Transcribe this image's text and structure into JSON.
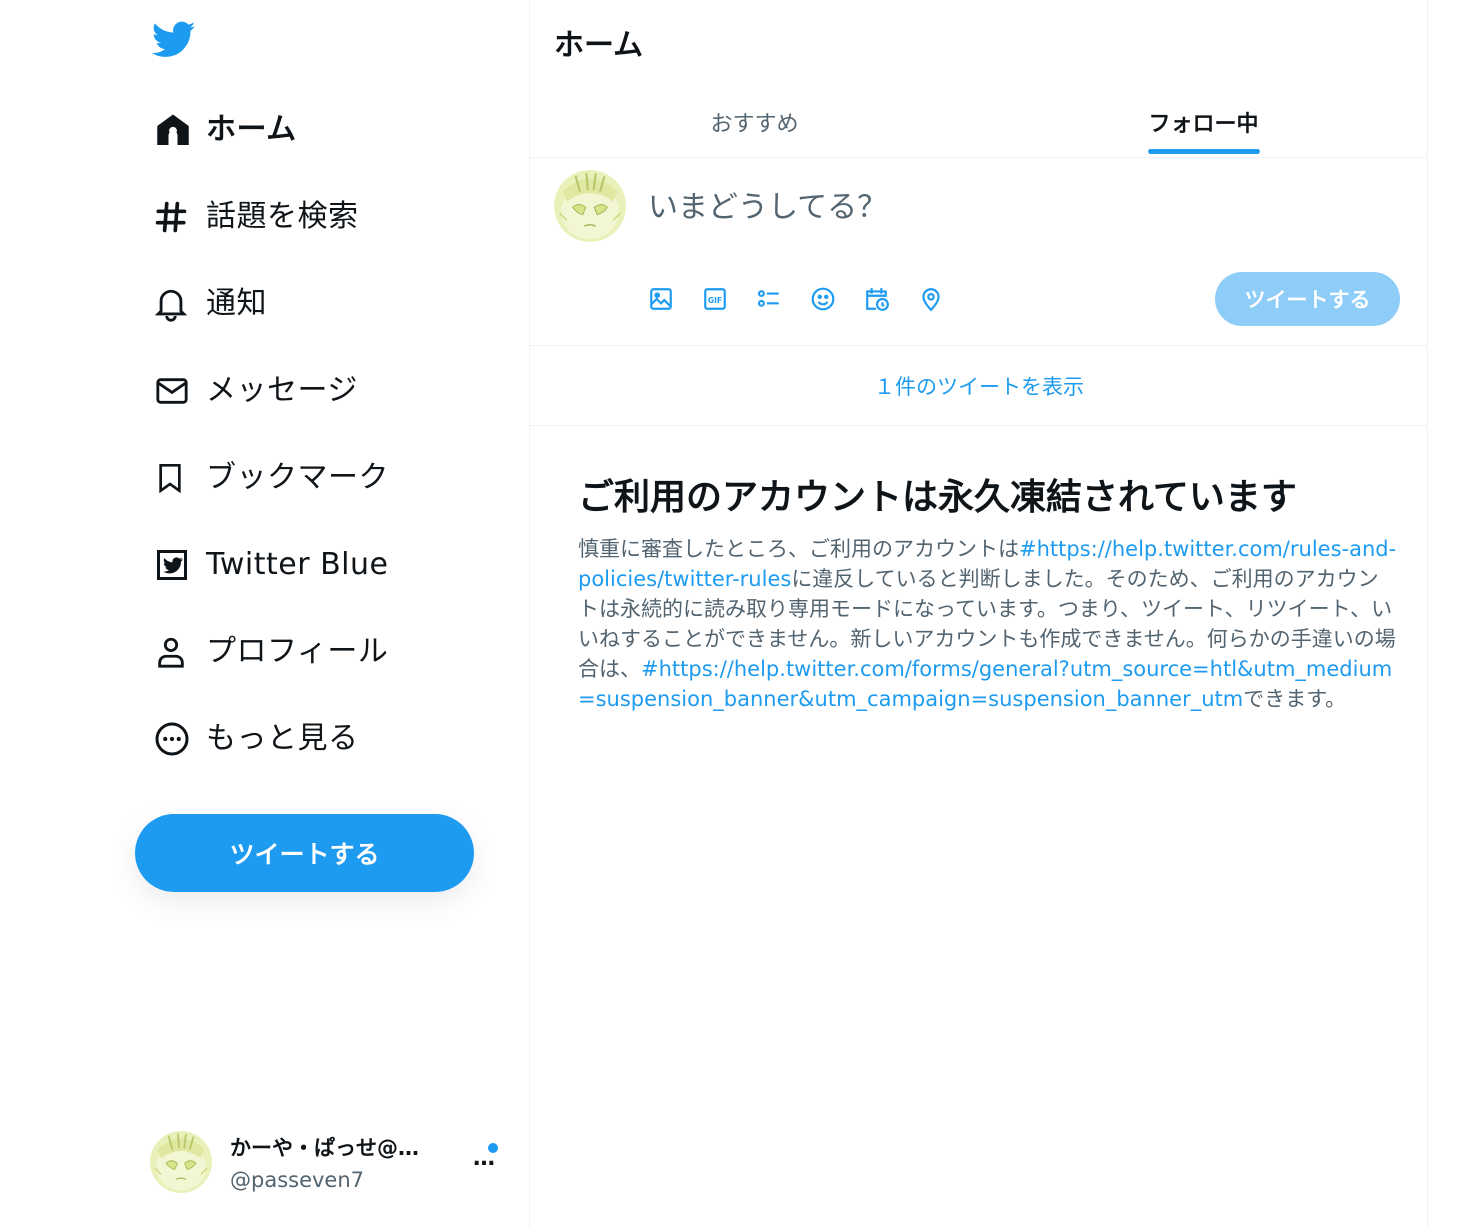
{
  "colors": {
    "accent": "#1d9bf0",
    "accent_disabled": "#8ecdf8",
    "text_primary": "#0f1419",
    "text_secondary": "#536471",
    "border": "#eff3f4"
  },
  "sidebar": {
    "logo_icon": "twitter-bird-icon",
    "nav": [
      {
        "label": "ホーム",
        "icon": "home-icon",
        "active": true
      },
      {
        "label": "話題を検索",
        "icon": "hashtag-icon"
      },
      {
        "label": "通知",
        "icon": "bell-icon"
      },
      {
        "label": "メッセージ",
        "icon": "envelope-icon"
      },
      {
        "label": "ブックマーク",
        "icon": "bookmark-icon"
      },
      {
        "label": "Twitter Blue",
        "icon": "twitter-blue-icon"
      },
      {
        "label": "プロフィール",
        "icon": "person-icon"
      },
      {
        "label": "もっと見る",
        "icon": "more-circle-icon"
      }
    ],
    "tweet_button": "ツイートする",
    "account": {
      "name": "かーや・ぱっせ@…",
      "handle": "@passeven7",
      "more": "…"
    }
  },
  "main": {
    "title": "ホーム",
    "tabs": [
      {
        "label": "おすすめ",
        "active": false
      },
      {
        "label": "フォロー中",
        "active": true
      }
    ],
    "composer": {
      "placeholder": "いまどうしてる？",
      "tools": [
        "image-icon",
        "gif-icon",
        "poll-icon",
        "emoji-icon",
        "schedule-icon",
        "location-icon"
      ],
      "submit": "ツイートする"
    },
    "show_new_tweets": "１件のツイートを表示",
    "notice": {
      "title": "ご利用のアカウントは永久凍結されています",
      "body_1": "慎重に審査したところ、ご利用のアカウントは",
      "link_1": "#https://help.twitter.com/rules-and-policies/twitter-rules",
      "body_2": "に違反していると判断しました。そのため、ご利用のアカウントは永続的に読み取り専用モードになっています。つまり、ツイート、リツイート、いいねすることができません。新しいアカウントも作成できません。何らかの手違いの場合は、",
      "link_2": "#https://help.twitter.com/forms/general?utm_source=htl&utm_medium=suspension_banner&utm_campaign=suspension_banner_utm",
      "body_3": "できます。"
    }
  }
}
